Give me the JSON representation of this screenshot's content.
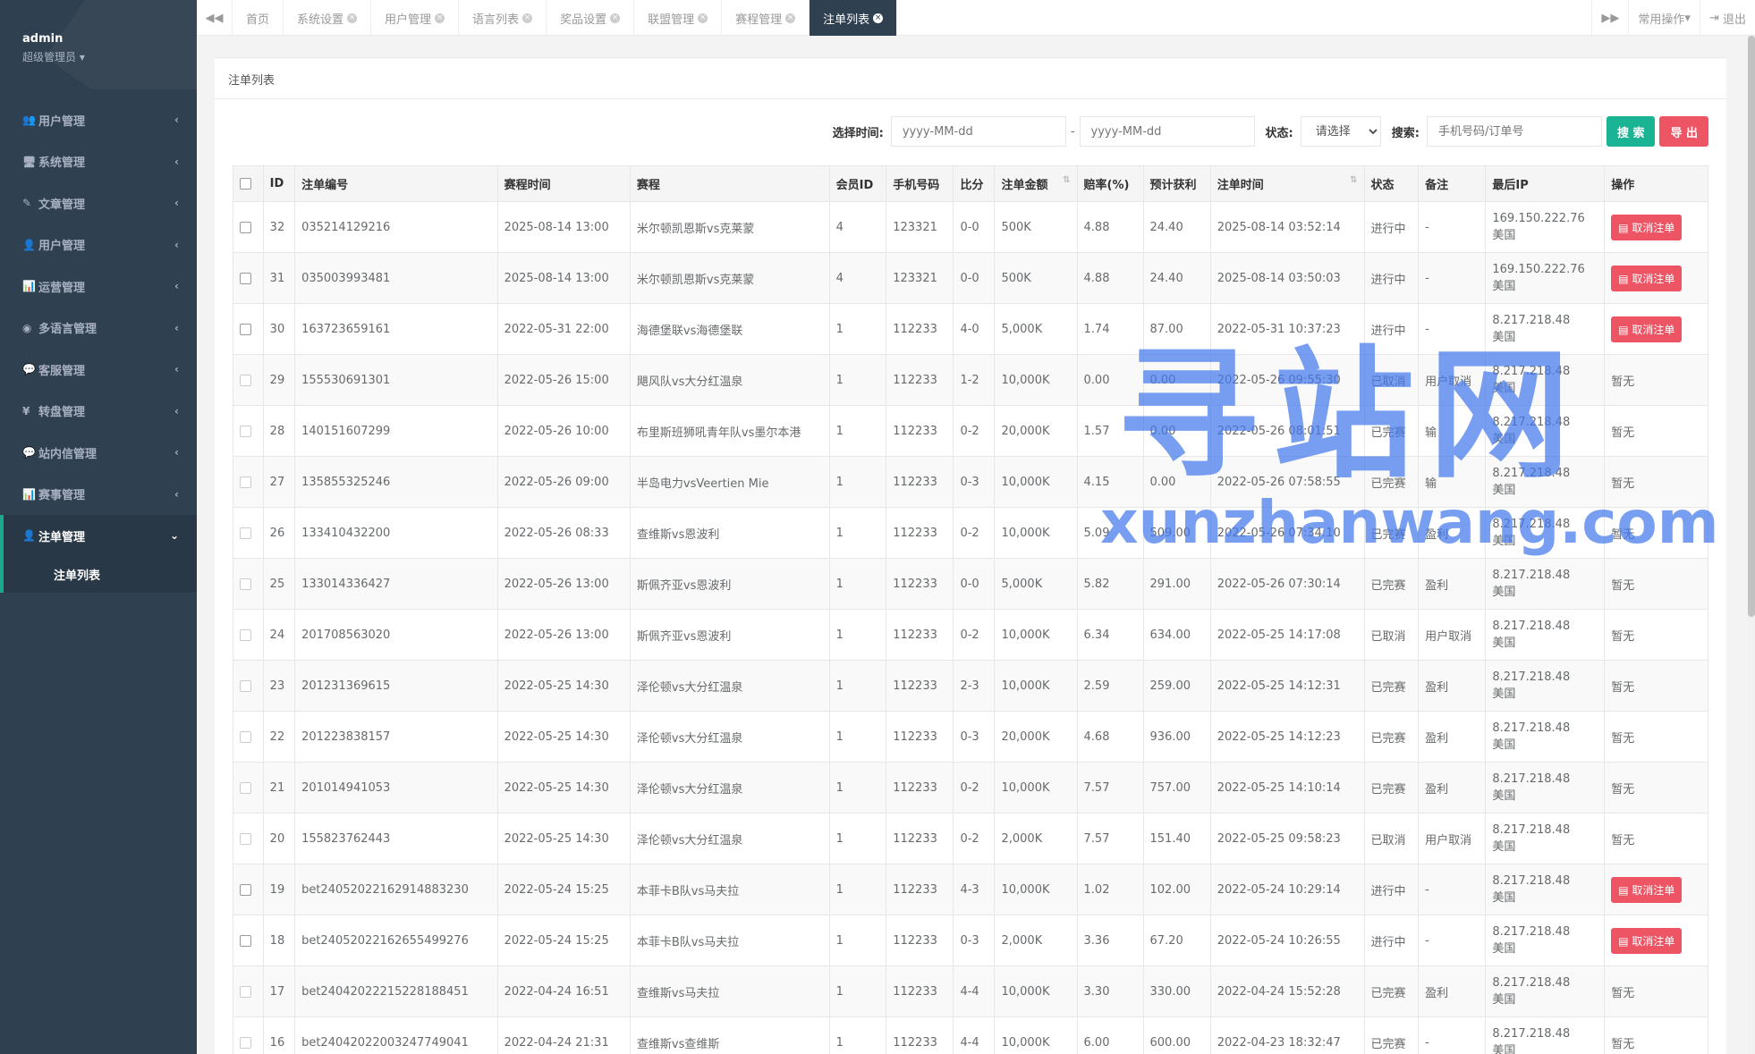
{
  "sidebar": {
    "username": "admin",
    "role": "超级管理员",
    "menu": [
      {
        "label": "用户管理",
        "icon": "users-icon",
        "glyph": "👥"
      },
      {
        "label": "系统管理",
        "icon": "desktop-icon",
        "glyph": "🖥"
      },
      {
        "label": "文章管理",
        "icon": "edit-icon",
        "glyph": "✎"
      },
      {
        "label": "用户管理",
        "icon": "user-icon",
        "glyph": "👤"
      },
      {
        "label": "运营管理",
        "icon": "bar-chart-icon",
        "glyph": "📊"
      },
      {
        "label": "多语言管理",
        "icon": "globe-icon",
        "glyph": "◉"
      },
      {
        "label": "客服管理",
        "icon": "comment-icon",
        "glyph": "💬"
      },
      {
        "label": "转盘管理",
        "icon": "yen-icon",
        "glyph": "¥"
      },
      {
        "label": "站内信管理",
        "icon": "comment-icon",
        "glyph": "💬"
      },
      {
        "label": "赛事管理",
        "icon": "bar-chart-icon",
        "glyph": "📊"
      }
    ],
    "active_menu": "注单管理",
    "active_sub": "注单列表"
  },
  "topbar": {
    "tabs": [
      {
        "label": "首页",
        "closable": false
      },
      {
        "label": "系统设置",
        "closable": true
      },
      {
        "label": "用户管理",
        "closable": true
      },
      {
        "label": "语言列表",
        "closable": true
      },
      {
        "label": "奖品设置",
        "closable": true
      },
      {
        "label": "联盟管理",
        "closable": true
      },
      {
        "label": "赛程管理",
        "closable": true
      },
      {
        "label": "注单列表",
        "closable": true,
        "active": true
      }
    ],
    "common_ops": "常用操作",
    "logout": "退出"
  },
  "panel": {
    "title": "注单列表",
    "filter": {
      "time_label": "选择时间:",
      "date_placeholder": "yyyy-MM-dd",
      "date_sep": "-",
      "status_label": "状态:",
      "status_selected": "请选择",
      "search_label": "搜索:",
      "search_placeholder": "手机号码/订单号",
      "search_btn": "搜 索",
      "export_btn": "导 出"
    }
  },
  "table": {
    "columns": [
      "ID",
      "注单编号",
      "赛程时间",
      "赛程",
      "会员ID",
      "手机号码",
      "比分",
      "注单金额",
      "赔率(%)",
      "预计获利",
      "注单时间",
      "状态",
      "备注",
      "最后IP",
      "操作"
    ],
    "cancel_label": "取消注单",
    "none_label": "暂无",
    "rows": [
      {
        "id": "32",
        "no": "035214129216",
        "match_time": "2025-08-14 13:00",
        "match": "米尔顿凯恩斯vs克莱蒙",
        "member": "4",
        "phone": "123321",
        "score": "0-0",
        "amount": "500K",
        "odds": "4.88",
        "profit": "24.40",
        "bet_time": "2025-08-14 03:52:14",
        "status": "进行中",
        "note": "-",
        "ip": "169.150.222.76",
        "region": "美国",
        "cancelable": true
      },
      {
        "id": "31",
        "no": "035003993481",
        "match_time": "2025-08-14 13:00",
        "match": "米尔顿凯恩斯vs克莱蒙",
        "member": "4",
        "phone": "123321",
        "score": "0-0",
        "amount": "500K",
        "odds": "4.88",
        "profit": "24.40",
        "bet_time": "2025-08-14 03:50:03",
        "status": "进行中",
        "note": "-",
        "ip": "169.150.222.76",
        "region": "美国",
        "cancelable": true
      },
      {
        "id": "30",
        "no": "163723659161",
        "match_time": "2022-05-31 22:00",
        "match": "海德堡联vs海德堡联",
        "member": "1",
        "phone": "112233",
        "score": "4-0",
        "amount": "5,000K",
        "odds": "1.74",
        "profit": "87.00",
        "bet_time": "2022-05-31 10:37:23",
        "status": "进行中",
        "note": "-",
        "ip": "8.217.218.48",
        "region": "美国",
        "cancelable": true
      },
      {
        "id": "29",
        "no": "155530691301",
        "match_time": "2022-05-26 15:00",
        "match": "飓风队vs大分红温泉",
        "member": "1",
        "phone": "112233",
        "score": "1-2",
        "amount": "10,000K",
        "odds": "0.00",
        "profit": "0.00",
        "bet_time": "2022-05-26 09:55:30",
        "status": "已取消",
        "note": "用户取消",
        "ip": "8.217.218.48",
        "region": "美国",
        "cancelable": false
      },
      {
        "id": "28",
        "no": "140151607299",
        "match_time": "2022-05-26 10:00",
        "match": "布里斯班狮吼青年队vs墨尔本港",
        "member": "1",
        "phone": "112233",
        "score": "0-2",
        "amount": "20,000K",
        "odds": "1.57",
        "profit": "0.00",
        "bet_time": "2022-05-26 08:01:51",
        "status": "已完赛",
        "note": "输",
        "ip": "8.217.218.48",
        "region": "美国",
        "cancelable": false
      },
      {
        "id": "27",
        "no": "135855325246",
        "match_time": "2022-05-26 09:00",
        "match": "半岛电力vsVeertien Mie",
        "member": "1",
        "phone": "112233",
        "score": "0-3",
        "amount": "10,000K",
        "odds": "4.15",
        "profit": "0.00",
        "bet_time": "2022-05-26 07:58:55",
        "status": "已完赛",
        "note": "输",
        "ip": "8.217.218.48",
        "region": "美国",
        "cancelable": false
      },
      {
        "id": "26",
        "no": "133410432200",
        "match_time": "2022-05-26 08:33",
        "match": "查维斯vs恩波利",
        "member": "1",
        "phone": "112233",
        "score": "0-2",
        "amount": "10,000K",
        "odds": "5.09",
        "profit": "509.00",
        "bet_time": "2022-05-26 07:34:10",
        "status": "已完赛",
        "note": "盈利",
        "ip": "8.217.218.48",
        "region": "美国",
        "cancelable": false
      },
      {
        "id": "25",
        "no": "133014336427",
        "match_time": "2022-05-26 13:00",
        "match": "斯佩齐亚vs恩波利",
        "member": "1",
        "phone": "112233",
        "score": "0-0",
        "amount": "5,000K",
        "odds": "5.82",
        "profit": "291.00",
        "bet_time": "2022-05-26 07:30:14",
        "status": "已完赛",
        "note": "盈利",
        "ip": "8.217.218.48",
        "region": "美国",
        "cancelable": false
      },
      {
        "id": "24",
        "no": "201708563020",
        "match_time": "2022-05-26 13:00",
        "match": "斯佩齐亚vs恩波利",
        "member": "1",
        "phone": "112233",
        "score": "0-2",
        "amount": "10,000K",
        "odds": "6.34",
        "profit": "634.00",
        "bet_time": "2022-05-25 14:17:08",
        "status": "已取消",
        "note": "用户取消",
        "ip": "8.217.218.48",
        "region": "美国",
        "cancelable": false
      },
      {
        "id": "23",
        "no": "201231369615",
        "match_time": "2022-05-25 14:30",
        "match": "泽伦顿vs大分红温泉",
        "member": "1",
        "phone": "112233",
        "score": "2-3",
        "amount": "10,000K",
        "odds": "2.59",
        "profit": "259.00",
        "bet_time": "2022-05-25 14:12:31",
        "status": "已完赛",
        "note": "盈利",
        "ip": "8.217.218.48",
        "region": "美国",
        "cancelable": false
      },
      {
        "id": "22",
        "no": "201223838157",
        "match_time": "2022-05-25 14:30",
        "match": "泽伦顿vs大分红温泉",
        "member": "1",
        "phone": "112233",
        "score": "0-3",
        "amount": "20,000K",
        "odds": "4.68",
        "profit": "936.00",
        "bet_time": "2022-05-25 14:12:23",
        "status": "已完赛",
        "note": "盈利",
        "ip": "8.217.218.48",
        "region": "美国",
        "cancelable": false
      },
      {
        "id": "21",
        "no": "201014941053",
        "match_time": "2022-05-25 14:30",
        "match": "泽伦顿vs大分红温泉",
        "member": "1",
        "phone": "112233",
        "score": "0-2",
        "amount": "10,000K",
        "odds": "7.57",
        "profit": "757.00",
        "bet_time": "2022-05-25 14:10:14",
        "status": "已完赛",
        "note": "盈利",
        "ip": "8.217.218.48",
        "region": "美国",
        "cancelable": false
      },
      {
        "id": "20",
        "no": "155823762443",
        "match_time": "2022-05-25 14:30",
        "match": "泽伦顿vs大分红温泉",
        "member": "1",
        "phone": "112233",
        "score": "0-2",
        "amount": "2,000K",
        "odds": "7.57",
        "profit": "151.40",
        "bet_time": "2022-05-25 09:58:23",
        "status": "已取消",
        "note": "用户取消",
        "ip": "8.217.218.48",
        "region": "美国",
        "cancelable": false
      },
      {
        "id": "19",
        "no": "bet24052022162914883230",
        "match_time": "2022-05-24 15:25",
        "match": "本菲卡B队vs马夫拉",
        "member": "1",
        "phone": "112233",
        "score": "4-3",
        "amount": "10,000K",
        "odds": "1.02",
        "profit": "102.00",
        "bet_time": "2022-05-24 10:29:14",
        "status": "进行中",
        "note": "-",
        "ip": "8.217.218.48",
        "region": "美国",
        "cancelable": true
      },
      {
        "id": "18",
        "no": "bet24052022162655499276",
        "match_time": "2022-05-24 15:25",
        "match": "本菲卡B队vs马夫拉",
        "member": "1",
        "phone": "112233",
        "score": "0-3",
        "amount": "2,000K",
        "odds": "3.36",
        "profit": "67.20",
        "bet_time": "2022-05-24 10:26:55",
        "status": "进行中",
        "note": "-",
        "ip": "8.217.218.48",
        "region": "美国",
        "cancelable": true
      },
      {
        "id": "17",
        "no": "bet24042022215228188451",
        "match_time": "2022-04-24 16:51",
        "match": "查维斯vs马夫拉",
        "member": "1",
        "phone": "112233",
        "score": "4-4",
        "amount": "10,000K",
        "odds": "3.30",
        "profit": "330.00",
        "bet_time": "2022-04-24 15:52:28",
        "status": "已完赛",
        "note": "盈利",
        "ip": "8.217.218.48",
        "region": "美国",
        "cancelable": false
      },
      {
        "id": "16",
        "no": "bet24042022003247749041",
        "match_time": "2022-04-24 21:31",
        "match": "查维斯vs查维斯",
        "member": "1",
        "phone": "112233",
        "score": "4-4",
        "amount": "10,000K",
        "odds": "6.00",
        "profit": "600.00",
        "bet_time": "2022-04-23 18:32:47",
        "status": "已完赛",
        "note": "-",
        "ip": "8.217.218.48",
        "region": "美国",
        "cancelable": false
      }
    ]
  },
  "watermark": {
    "cn": "寻站网",
    "en": "xunzhanwang.com"
  }
}
